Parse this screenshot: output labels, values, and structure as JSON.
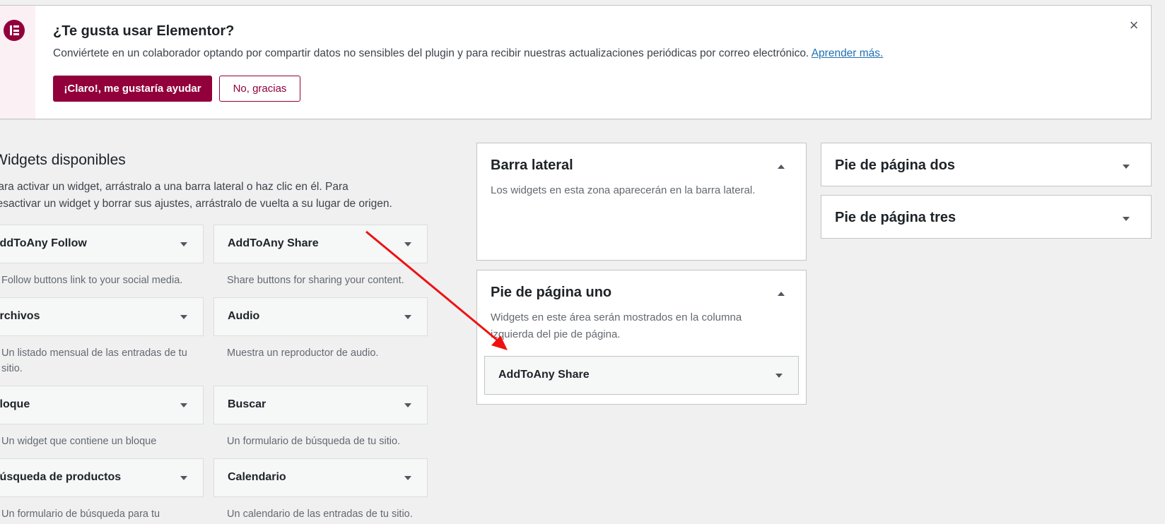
{
  "notice": {
    "title": "¿Te gusta usar Elementor?",
    "description": "Conviértete en un colaborador optando por compartir datos no sensibles del plugin y para recibir nuestras actualizaciones periódicas por correo electrónico.",
    "learn_more": "Aprender más.",
    "accept_label": "¡Claro!, me gustaría ayudar",
    "decline_label": "No, gracias",
    "dismiss_icon": "×",
    "brand_color": "#92003b"
  },
  "available": {
    "title": "Widgets disponibles",
    "description_line1": "Para activar un widget, arrástralo a una barra lateral o haz clic en él. Para",
    "description_line2": "desactivar un widget y borrar sus ajustes, arrástralo de vuelta a su lugar de origen.",
    "widgets": [
      {
        "label": "AddToAny Follow",
        "description": "Follow buttons link to your social media."
      },
      {
        "label": "AddToAny Share",
        "description": "Share buttons for sharing your content."
      },
      {
        "label": "Archivos",
        "description": "Un listado mensual de las entradas de tu sitio."
      },
      {
        "label": "Audio",
        "description": "Muestra un reproductor de audio."
      },
      {
        "label": "Bloque",
        "description": "Un widget que contiene un bloque"
      },
      {
        "label": "Buscar",
        "description": "Un formulario de búsqueda de tu sitio."
      },
      {
        "label": "Búsqueda de productos",
        "description": "Un formulario de búsqueda para tu"
      },
      {
        "label": "Calendario",
        "description": "Un calendario de las entradas de tu sitio."
      }
    ]
  },
  "sidebars": {
    "barra_lateral": {
      "title": "Barra lateral",
      "description": "Los widgets en esta zona aparecerán en la barra lateral."
    },
    "pie_uno": {
      "title": "Pie de página uno",
      "description": "Widgets en este área serán mostrados en la columna izquierda del pie de página.",
      "placed_widget": "AddToAny Share"
    },
    "pie_dos": {
      "title": "Pie de página dos"
    },
    "pie_tres": {
      "title": "Pie de página tres"
    }
  },
  "annotation": {
    "arrow_color": "#ee1111"
  }
}
